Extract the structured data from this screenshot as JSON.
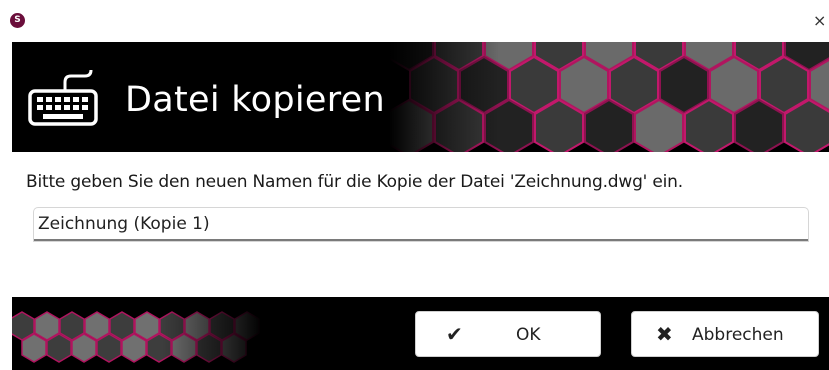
{
  "window": {
    "app_icon_glyph": "S",
    "close_glyph": "×"
  },
  "dialog": {
    "title": "Datei kopieren",
    "prompt": "Bitte geben Sie den neuen Namen für die Kopie der Datei 'Zeichnung.dwg' ein.",
    "input_value": "Zeichnung (Kopie 1)",
    "banner_icon": "keyboard-icon"
  },
  "buttons": {
    "ok_icon": "✔",
    "ok_label": "OK",
    "cancel_icon": "✖",
    "cancel_label": "Abbrechen"
  },
  "colors": {
    "banner_bg": "#000000",
    "hex_glow": "#c2186b",
    "app_icon": "#6b0e3b"
  }
}
